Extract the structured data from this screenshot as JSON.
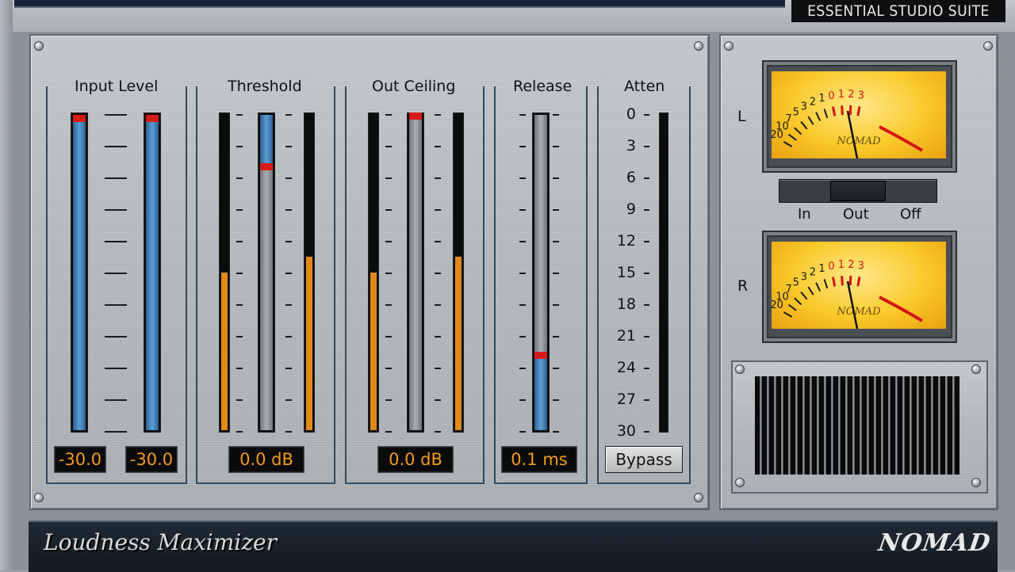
{
  "header": {
    "suite_label": "ESSENTIAL STUDIO SUITE"
  },
  "sections": {
    "input_level": {
      "title": "Input Level",
      "left_value": "-30.0",
      "right_value": "-30.0",
      "left_level": 1.0,
      "right_level": 1.0
    },
    "threshold": {
      "title": "Threshold",
      "value": "0.0 dB",
      "slider_level": 0.84,
      "meter_left_level": 0.5,
      "meter_right_level": 0.55
    },
    "out_ceiling": {
      "title": "Out Ceiling",
      "value": "0.0 dB",
      "slider_level": 1.0,
      "meter_left_level": 0.5,
      "meter_right_level": 0.55
    },
    "release": {
      "title": "Release",
      "value": "0.1 ms",
      "slider_level": 0.24
    },
    "atten": {
      "title": "Atten",
      "scale": [
        "0",
        "3",
        "6",
        "9",
        "12",
        "15",
        "18",
        "21",
        "24",
        "27",
        "30"
      ],
      "bypass_label": "Bypass"
    }
  },
  "vu_meters": {
    "left_label": "L",
    "right_label": "R",
    "scale_left": [
      "20",
      "10",
      "7",
      "5",
      "3",
      "2",
      "1"
    ],
    "scale_right": [
      "0",
      "1",
      "2",
      "3"
    ],
    "brand": "NOMAD"
  },
  "switch": {
    "labels": [
      "In",
      "Out",
      "Off"
    ],
    "selected": "Out"
  },
  "footer": {
    "product_name": "Loudness Maximizer",
    "logo_text": "NOMAD"
  },
  "colors": {
    "meter_blue": "#4a8fc9",
    "meter_orange": "#e18a17",
    "peak_red": "#d61b16",
    "display_text": "#f39a1b",
    "vu_face": "#f9c92a"
  }
}
